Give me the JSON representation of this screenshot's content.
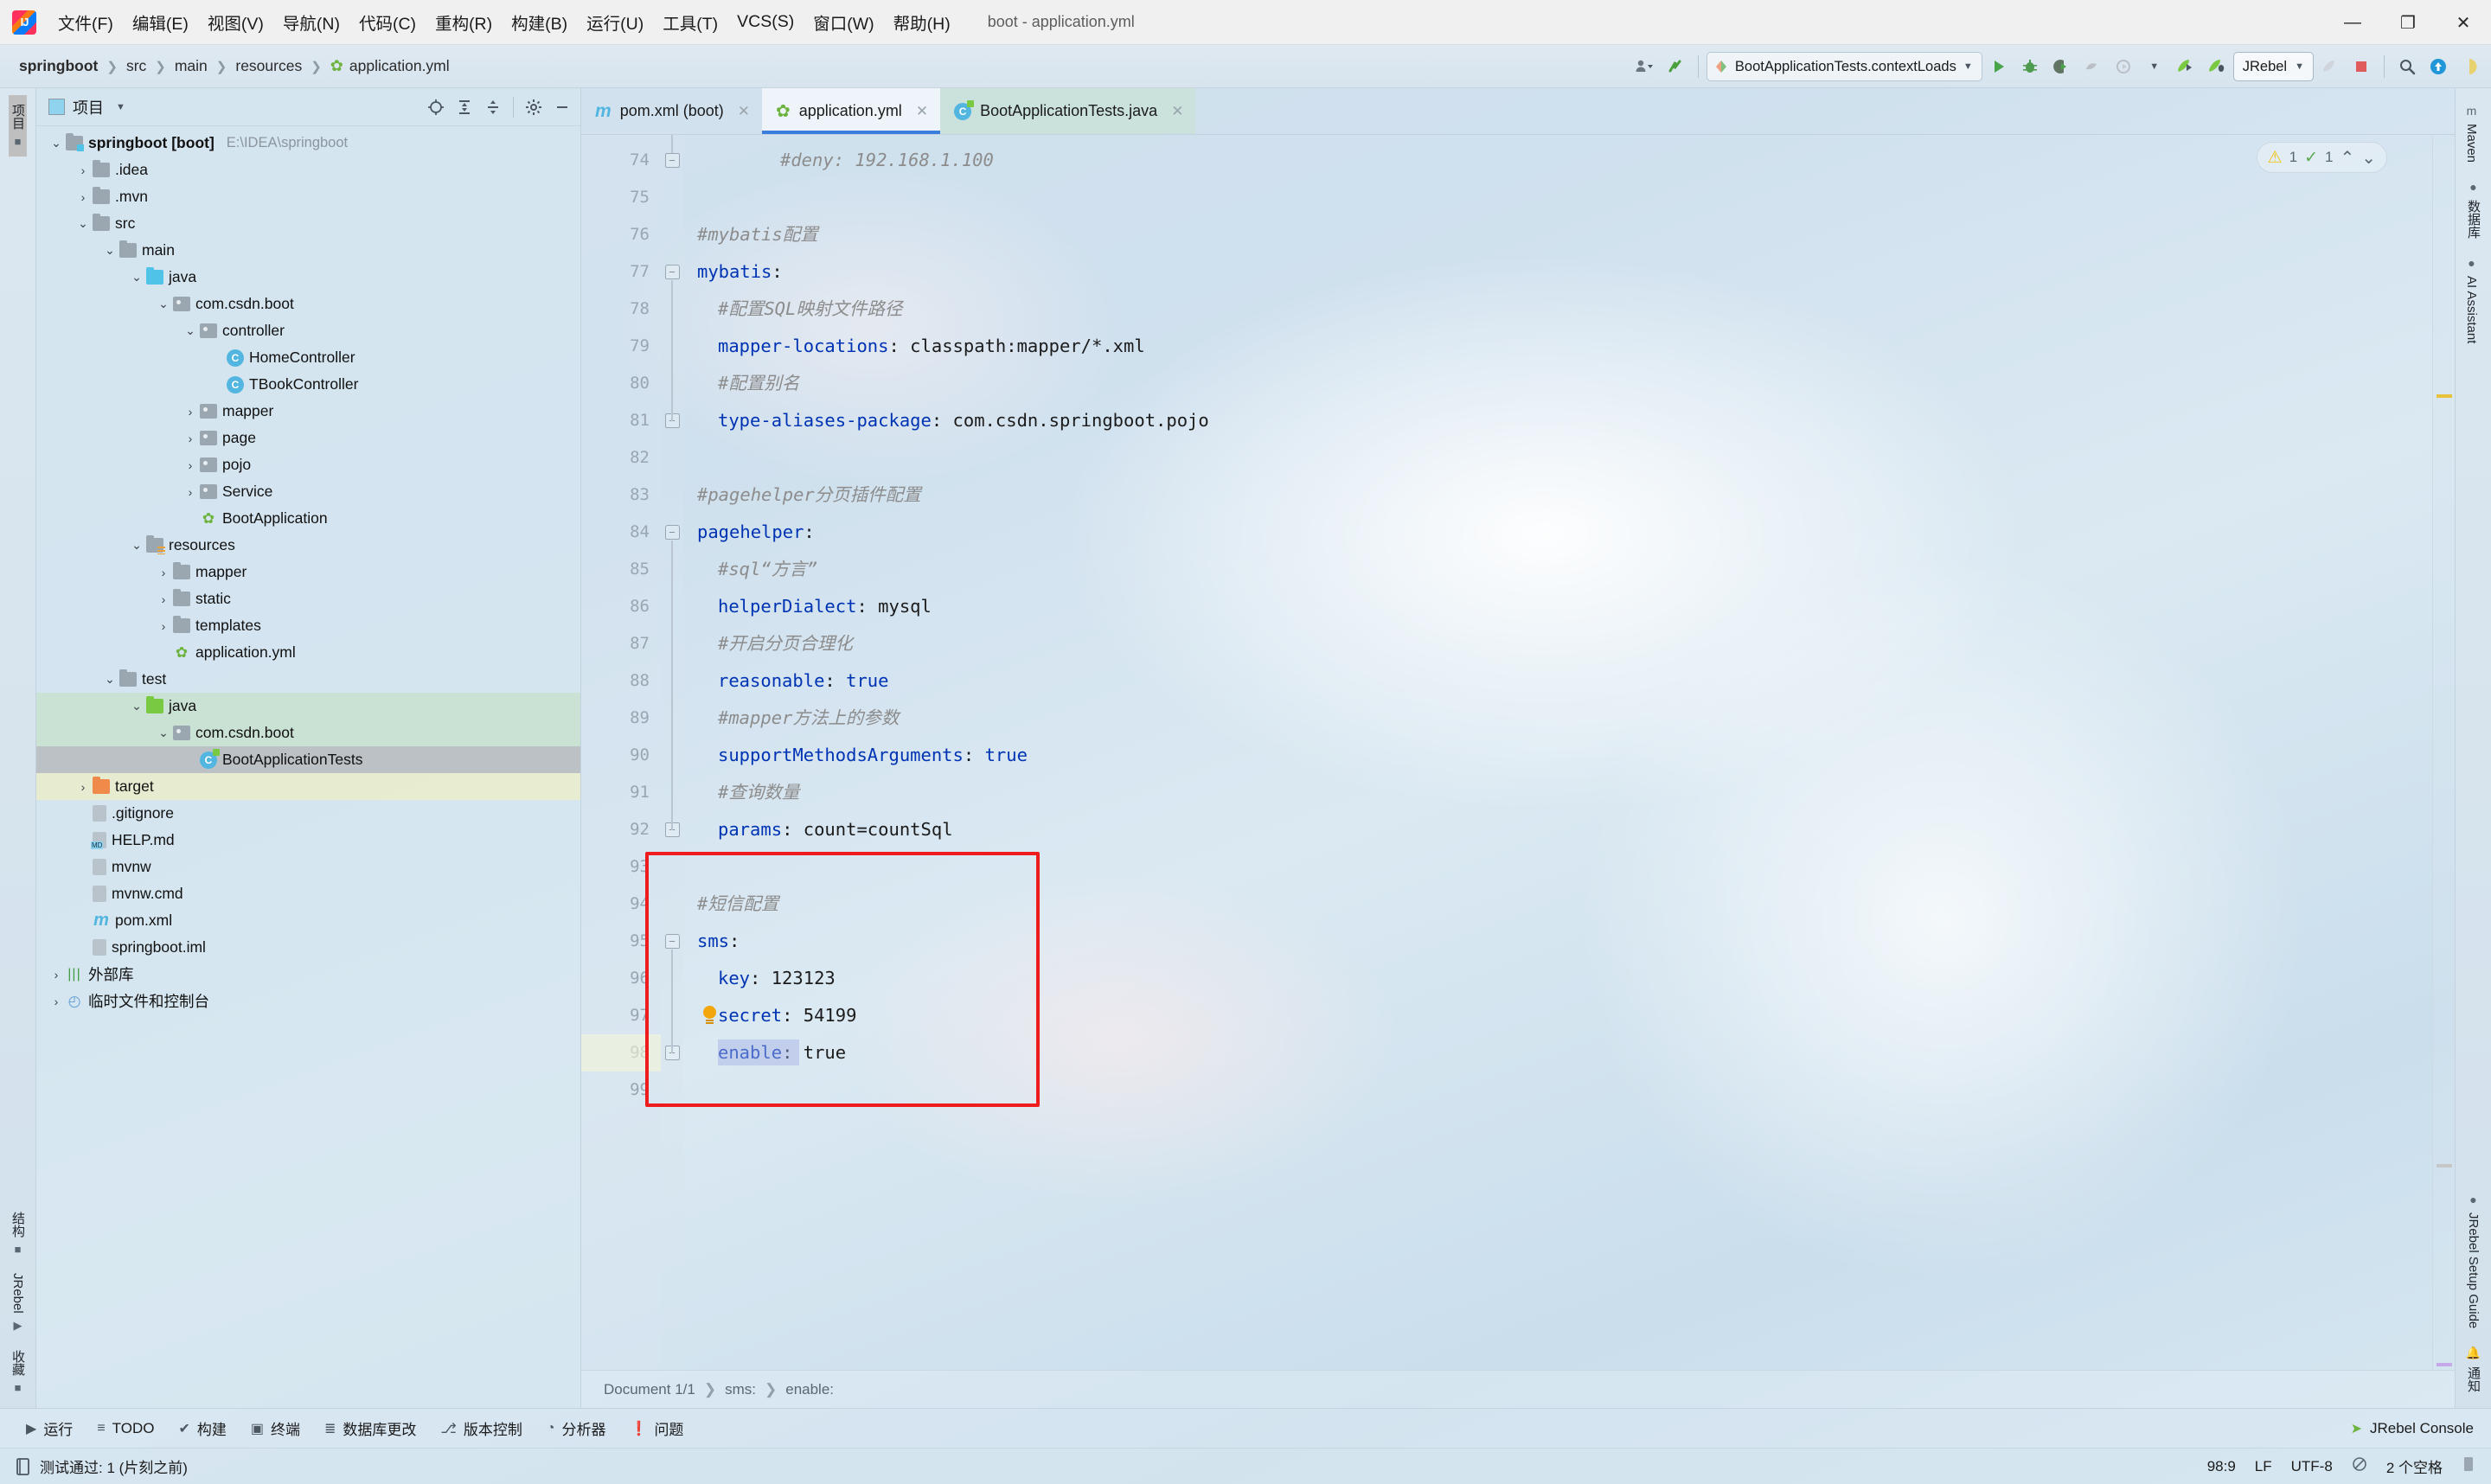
{
  "window": {
    "title": "boot - application.yml",
    "minimize": "—",
    "maximize": "❐",
    "close": "✕"
  },
  "menubar": {
    "items": [
      "文件(F)",
      "编辑(E)",
      "视图(V)",
      "导航(N)",
      "代码(C)",
      "重构(R)",
      "构建(B)",
      "运行(U)",
      "工具(T)",
      "VCS(S)",
      "窗口(W)",
      "帮助(H)"
    ]
  },
  "navbar": {
    "breadcrumbs": [
      "springboot",
      "src",
      "main",
      "resources",
      "application.yml"
    ],
    "run_config": "BootApplicationTests.contextLoads",
    "jrebel_label": "JRebel",
    "icons": [
      "user-dropdown-icon",
      "updates-icon",
      "run-icon",
      "debug-icon",
      "coverage-icon",
      "profiler-icon",
      "run-with-profiler-icon",
      "jrebel-run-icon",
      "jrebel-debug-icon",
      "jrebel-deploy-icon",
      "stop-icon",
      "search-everywhere-icon",
      "update-project-icon",
      "ai-assistant-icon"
    ]
  },
  "left_rail": {
    "top": [
      {
        "label": "项目",
        "icon": "project-icon",
        "active": true
      }
    ],
    "bottom": [
      {
        "label": "结构",
        "icon": "structure-icon"
      },
      {
        "label": "JRebel",
        "icon": "jrebel-icon"
      },
      {
        "label": "收藏",
        "icon": "bookmarks-icon"
      }
    ]
  },
  "project_panel": {
    "title": "项目",
    "tools": [
      "locate-icon",
      "expand-all-icon",
      "collapse-all-icon",
      "settings-icon",
      "hide-icon"
    ],
    "tree": [
      {
        "depth": 0,
        "twist": "v",
        "icon": "folder-src",
        "label": "springboot [boot]",
        "bold": true,
        "path": "E:\\IDEA\\springboot"
      },
      {
        "depth": 1,
        "twist": ">",
        "icon": "folder",
        "label": ".idea"
      },
      {
        "depth": 1,
        "twist": ">",
        "icon": "folder",
        "label": ".mvn"
      },
      {
        "depth": 1,
        "twist": "v",
        "icon": "folder",
        "label": "src"
      },
      {
        "depth": 2,
        "twist": "v",
        "icon": "folder",
        "label": "main"
      },
      {
        "depth": 3,
        "twist": "v",
        "icon": "folder-blue",
        "label": "java"
      },
      {
        "depth": 4,
        "twist": "v",
        "icon": "package",
        "label": "com.csdn.boot"
      },
      {
        "depth": 5,
        "twist": "v",
        "icon": "package",
        "label": "controller"
      },
      {
        "depth": 6,
        "twist": "",
        "icon": "class",
        "label": "HomeController"
      },
      {
        "depth": 6,
        "twist": "",
        "icon": "class",
        "label": "TBookController"
      },
      {
        "depth": 5,
        "twist": ">",
        "icon": "package",
        "label": "mapper"
      },
      {
        "depth": 5,
        "twist": ">",
        "icon": "package",
        "label": "page"
      },
      {
        "depth": 5,
        "twist": ">",
        "icon": "package",
        "label": "pojo"
      },
      {
        "depth": 5,
        "twist": ">",
        "icon": "package",
        "label": "Service"
      },
      {
        "depth": 5,
        "twist": "",
        "icon": "spring-class",
        "label": "BootApplication"
      },
      {
        "depth": 3,
        "twist": "v",
        "icon": "folder-resources",
        "label": "resources"
      },
      {
        "depth": 4,
        "twist": ">",
        "icon": "folder",
        "label": "mapper"
      },
      {
        "depth": 4,
        "twist": ">",
        "icon": "folder",
        "label": "static"
      },
      {
        "depth": 4,
        "twist": ">",
        "icon": "folder",
        "label": "templates"
      },
      {
        "depth": 4,
        "twist": "",
        "icon": "spring-yml",
        "label": "application.yml"
      },
      {
        "depth": 2,
        "twist": "v",
        "icon": "folder",
        "label": "test"
      },
      {
        "depth": 3,
        "twist": "v",
        "icon": "folder-green",
        "label": "java",
        "highlight": "green"
      },
      {
        "depth": 4,
        "twist": "v",
        "icon": "package",
        "label": "com.csdn.boot",
        "highlight": "green"
      },
      {
        "depth": 5,
        "twist": "",
        "icon": "test-class",
        "label": "BootApplicationTests",
        "highlight": "gray"
      },
      {
        "depth": 1,
        "twist": ">",
        "icon": "folder-orange",
        "label": "target",
        "highlight": "yellow"
      },
      {
        "depth": 1,
        "twist": "",
        "icon": "gitignore",
        "label": ".gitignore"
      },
      {
        "depth": 1,
        "twist": "",
        "icon": "markdown",
        "label": "HELP.md"
      },
      {
        "depth": 1,
        "twist": "",
        "icon": "script",
        "label": "mvnw"
      },
      {
        "depth": 1,
        "twist": "",
        "icon": "cmd",
        "label": "mvnw.cmd"
      },
      {
        "depth": 1,
        "twist": "",
        "icon": "maven",
        "label": "pom.xml"
      },
      {
        "depth": 1,
        "twist": "",
        "icon": "iml",
        "label": "springboot.iml"
      },
      {
        "depth": 0,
        "twist": ">",
        "icon": "library",
        "label": "外部库"
      },
      {
        "depth": 0,
        "twist": ">",
        "icon": "scratches",
        "label": "临时文件和控制台"
      }
    ]
  },
  "editor": {
    "tabs": [
      {
        "label": "pom.xml (boot)",
        "icon": "maven-icon",
        "state": "normal"
      },
      {
        "label": "application.yml",
        "icon": "spring-yml-icon",
        "state": "active"
      },
      {
        "label": "BootApplicationTests.java",
        "icon": "test-class-icon",
        "state": "tinted"
      }
    ],
    "inspection": {
      "warning_count": "1",
      "ok_count": "1",
      "up": "⌃",
      "down": "⌄"
    },
    "first_line_number": 74,
    "lines": [
      {
        "n": 74,
        "fold": "end",
        "indent": 4,
        "tokens": [
          {
            "t": "c",
            "s": "#deny: 192.168.1.100"
          }
        ]
      },
      {
        "n": 75,
        "fold": "",
        "indent": 0,
        "tokens": []
      },
      {
        "n": 76,
        "fold": "",
        "indent": 0,
        "tokens": [
          {
            "t": "c",
            "s": "#mybatis配置"
          }
        ]
      },
      {
        "n": 77,
        "fold": "start",
        "indent": 0,
        "tokens": [
          {
            "t": "k",
            "s": "mybatis"
          },
          {
            "t": "p",
            "s": ":"
          }
        ]
      },
      {
        "n": 78,
        "fold": "",
        "indent": 1,
        "tokens": [
          {
            "t": "c",
            "s": "#配置SQL映射文件路径"
          }
        ]
      },
      {
        "n": 79,
        "fold": "",
        "indent": 1,
        "tokens": [
          {
            "t": "k",
            "s": "mapper-locations"
          },
          {
            "t": "p",
            "s": ": "
          },
          {
            "t": "v",
            "s": "classpath:mapper/*.xml"
          }
        ]
      },
      {
        "n": 80,
        "fold": "",
        "indent": 1,
        "tokens": [
          {
            "t": "c",
            "s": "#配置别名"
          }
        ]
      },
      {
        "n": 81,
        "fold": "end",
        "indent": 1,
        "tokens": [
          {
            "t": "k",
            "s": "type-aliases-package"
          },
          {
            "t": "p",
            "s": ": "
          },
          {
            "t": "v",
            "s": "com.csdn.springboot.pojo"
          }
        ]
      },
      {
        "n": 82,
        "fold": "",
        "indent": 0,
        "tokens": []
      },
      {
        "n": 83,
        "fold": "",
        "indent": 0,
        "tokens": [
          {
            "t": "c",
            "s": "#pagehelper分页插件配置"
          }
        ]
      },
      {
        "n": 84,
        "fold": "start",
        "indent": 0,
        "tokens": [
          {
            "t": "k",
            "s": "pagehelper"
          },
          {
            "t": "p",
            "s": ":"
          }
        ]
      },
      {
        "n": 85,
        "fold": "",
        "indent": 1,
        "tokens": [
          {
            "t": "c",
            "s": "#sql“方言”"
          }
        ]
      },
      {
        "n": 86,
        "fold": "",
        "indent": 1,
        "tokens": [
          {
            "t": "k",
            "s": "helperDialect"
          },
          {
            "t": "p",
            "s": ": "
          },
          {
            "t": "v",
            "s": "mysql"
          }
        ]
      },
      {
        "n": 87,
        "fold": "",
        "indent": 1,
        "tokens": [
          {
            "t": "c",
            "s": "#开启分页合理化"
          }
        ]
      },
      {
        "n": 88,
        "fold": "",
        "indent": 1,
        "tokens": [
          {
            "t": "k",
            "s": "reasonable"
          },
          {
            "t": "p",
            "s": ": "
          },
          {
            "t": "k",
            "s": "true"
          }
        ]
      },
      {
        "n": 89,
        "fold": "",
        "indent": 1,
        "tokens": [
          {
            "t": "c",
            "s": "#mapper方法上的参数"
          }
        ]
      },
      {
        "n": 90,
        "fold": "",
        "indent": 1,
        "tokens": [
          {
            "t": "k",
            "s": "supportMethodsArguments"
          },
          {
            "t": "p",
            "s": ": "
          },
          {
            "t": "k",
            "s": "true"
          }
        ]
      },
      {
        "n": 91,
        "fold": "",
        "indent": 1,
        "tokens": [
          {
            "t": "c",
            "s": "#查询数量"
          }
        ]
      },
      {
        "n": 92,
        "fold": "end",
        "indent": 1,
        "tokens": [
          {
            "t": "k",
            "s": "params"
          },
          {
            "t": "p",
            "s": ": "
          },
          {
            "t": "v",
            "s": "count=countSql"
          }
        ]
      },
      {
        "n": 93,
        "fold": "",
        "indent": 0,
        "tokens": []
      },
      {
        "n": 94,
        "fold": "",
        "indent": 0,
        "tokens": [
          {
            "t": "c",
            "s": "#短信配置"
          }
        ]
      },
      {
        "n": 95,
        "fold": "start",
        "indent": 0,
        "tokens": [
          {
            "t": "k",
            "s": "sms"
          },
          {
            "t": "p",
            "s": ":"
          }
        ]
      },
      {
        "n": 96,
        "fold": "",
        "indent": 1,
        "tokens": [
          {
            "t": "k",
            "s": "key"
          },
          {
            "t": "p",
            "s": ": "
          },
          {
            "t": "v",
            "s": "123123"
          }
        ]
      },
      {
        "n": 97,
        "fold": "",
        "indent": 1,
        "bulb": true,
        "tokens": [
          {
            "t": "k",
            "s": "secret"
          },
          {
            "t": "p",
            "s": ": "
          },
          {
            "t": "v",
            "s": "54199"
          }
        ]
      },
      {
        "n": 98,
        "fold": "end",
        "indent": 1,
        "current": true,
        "tokens": [
          {
            "t": "k",
            "s": "enable"
          },
          {
            "t": "p",
            "s": ": "
          },
          {
            "t": "v",
            "s": "true"
          }
        ]
      },
      {
        "n": 99,
        "fold": "",
        "indent": 0,
        "tokens": []
      }
    ],
    "annotation_box": {
      "from_line": 93,
      "to_line": 99,
      "color": "#ee1c1c"
    },
    "doc_breadcrumb": [
      "Document 1/1",
      "sms:",
      "enable:"
    ]
  },
  "right_rail": {
    "top": [
      {
        "label": "Maven",
        "icon": "maven-icon"
      },
      {
        "label": "数据库",
        "icon": "database-icon"
      },
      {
        "label": "AI Assistant",
        "icon": "ai-assistant-icon"
      }
    ],
    "bottom": [
      {
        "label": "JRebel Setup Guide",
        "icon": "jrebel-icon"
      },
      {
        "label": "通知",
        "icon": "notifications-icon",
        "badge": true
      }
    ]
  },
  "bottom_toolbar": {
    "items": [
      {
        "label": "运行",
        "icon": "run-icon"
      },
      {
        "label": "TODO",
        "icon": "todo-icon"
      },
      {
        "label": "构建",
        "icon": "build-icon"
      },
      {
        "label": "终端",
        "icon": "terminal-icon"
      },
      {
        "label": "数据库更改",
        "icon": "db-changes-icon"
      },
      {
        "label": "版本控制",
        "icon": "vcs-icon"
      },
      {
        "label": "分析器",
        "icon": "profiler-icon"
      },
      {
        "label": "问题",
        "icon": "problems-icon"
      }
    ],
    "right": {
      "label": "JRebel Console",
      "icon": "jrebel-icon"
    }
  },
  "statusbar": {
    "message": "测试通过: 1 (片刻之前)",
    "message_icon": "test-results-icon",
    "caret_position": "98:9",
    "line_separator": "LF",
    "encoding": "UTF-8",
    "read_only_icon": "lock-icon",
    "indent": "2 个空格"
  }
}
